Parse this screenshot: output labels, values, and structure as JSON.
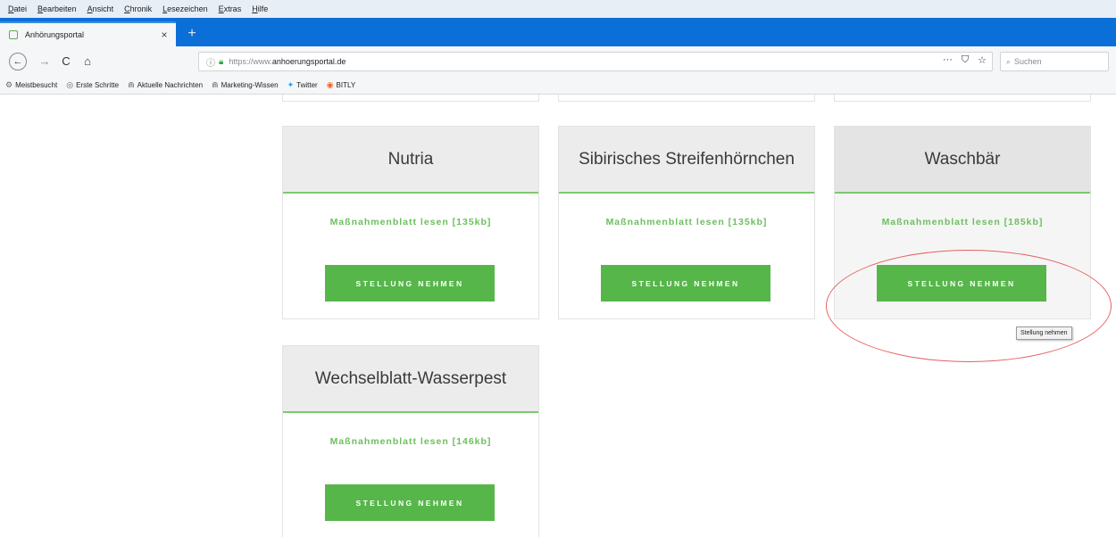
{
  "menu": [
    "Datei",
    "Bearbeiten",
    "Ansicht",
    "Chronik",
    "Lesezeichen",
    "Extras",
    "Hilfe"
  ],
  "tab": {
    "title": "Anhörungsportal",
    "close": "×",
    "new_tab": "+"
  },
  "nav": {
    "back": "←",
    "forward": "→",
    "reload": "C",
    "home": "⌂",
    "url_protocol": "https://www.",
    "url_host": "anhoerungsportal.de",
    "tools": [
      "···",
      "⛉",
      "☆"
    ],
    "search_placeholder": "Suchen"
  },
  "bookmarks": [
    {
      "icon": "⚙",
      "label": "Meistbesucht"
    },
    {
      "icon": "◎",
      "label": "Erste Schritte"
    },
    {
      "icon": "⋒",
      "label": "Aktuelle Nachrichten"
    },
    {
      "icon": "⋒",
      "label": "Marketing-Wissen"
    },
    {
      "icon": "✦",
      "label": "Twitter"
    },
    {
      "icon": "◉",
      "label": "BITLY"
    }
  ],
  "cards": [
    {
      "title": "Nutria",
      "link": "Maßnahmenblatt lesen [135kb]",
      "button": "STELLUNG NEHMEN"
    },
    {
      "title": "Sibirisches Streifenhörnchen",
      "link": "Maßnahmenblatt lesen [135kb]",
      "button": "STELLUNG NEHMEN"
    },
    {
      "title": "Waschbär",
      "link": "Maßnahmenblatt lesen [185kb]",
      "button": "STELLUNG NEHMEN"
    },
    {
      "title": "Wechselblatt-Wasserpest",
      "link": "Maßnahmenblatt lesen [146kb]",
      "button": "STELLUNG NEHMEN"
    }
  ],
  "tooltip": "Stellung nehmen",
  "colors": {
    "accent_green": "#56b64a",
    "link_green": "#6cbf5e",
    "annotation_red": "#e46360",
    "tab_strip_blue": "#0b6fd8"
  }
}
